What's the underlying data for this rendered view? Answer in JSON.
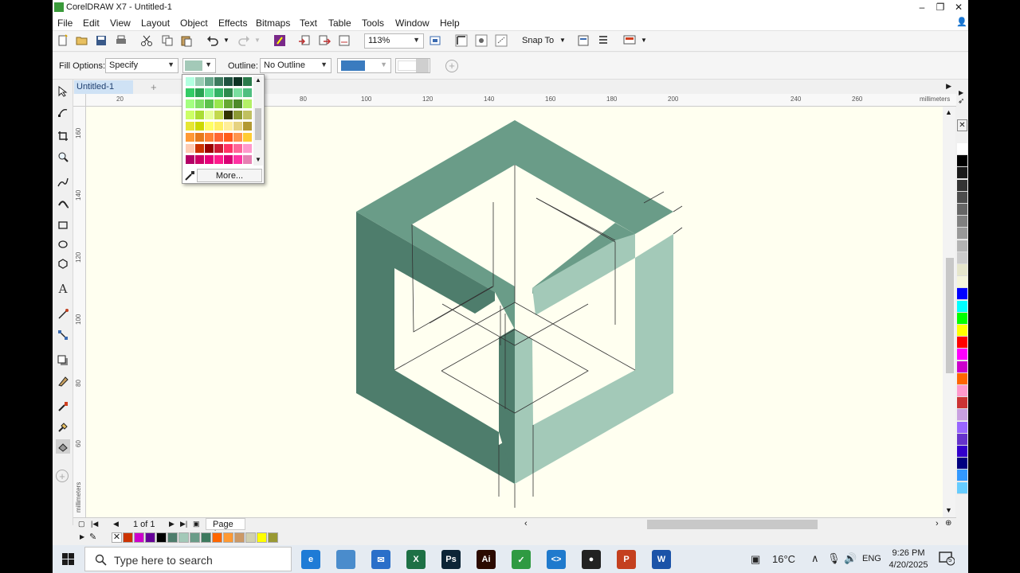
{
  "window": {
    "title": "CorelDRAW X7 - Untitled-1"
  },
  "menu": [
    "File",
    "Edit",
    "View",
    "Layout",
    "Object",
    "Effects",
    "Bitmaps",
    "Text",
    "Table",
    "Tools",
    "Window",
    "Help"
  ],
  "toolbar": {
    "zoom_value": "113%",
    "snap_label": "Snap To"
  },
  "property_bar": {
    "fill_options_label": "Fill Options:",
    "fill_options_value": "Specify",
    "outline_label": "Outline:",
    "outline_value": "No Outline",
    "fill_color": "#a3c9b8",
    "outline_color": "#3a7bbf"
  },
  "color_popup": {
    "more_label": "More...",
    "colors": [
      "#b2ffe0",
      "#99ccb3",
      "#66a68a",
      "#3d7a5e",
      "#1f5240",
      "#0d3324",
      "#2a7a4a",
      "#33cc66",
      "#29a352",
      "#66e699",
      "#33b366",
      "#2e8a4e",
      "#7adfa0",
      "#4fbf80",
      "#a3ff80",
      "#80e066",
      "#5cc24d",
      "#99e64d",
      "#66a833",
      "#4d8a2a",
      "#b3f066",
      "#ccff66",
      "#aadd33",
      "#e6ff99",
      "#c2d94d",
      "#333300",
      "#8c9933",
      "#c0c060",
      "#e6e633",
      "#ccd900",
      "#ffff66",
      "#fff066",
      "#ffee99",
      "#e6d280",
      "#b39933",
      "#ff9933",
      "#e67a1a",
      "#ff8033",
      "#ff6633",
      "#ff5c1a",
      "#ff944d",
      "#ffcc33",
      "#ffccb3",
      "#cc3300",
      "#990000",
      "#cc1a33",
      "#ff3366",
      "#ff6699",
      "#ff99cc",
      "#b30066",
      "#cc0066",
      "#e6007a",
      "#ff1a8c",
      "#d90073",
      "#ff33a3",
      "#e680b3"
    ]
  },
  "document": {
    "tab_label": "Untitled-1",
    "page_indicator": "1 of 1",
    "page_tab": "Page 1"
  },
  "rulers": {
    "horizontal": [
      "20",
      "80",
      "100",
      "120",
      "140",
      "160",
      "180",
      "200",
      "240",
      "260",
      "millimeters"
    ],
    "vertical": [
      "160",
      "140",
      "120",
      "100",
      "80",
      "60",
      "millimeters"
    ]
  },
  "cube": {
    "top_color": "#6a9c88",
    "left_color": "#4e7d6c",
    "right_color": "#a3c9b8",
    "line_color": "#333333"
  },
  "right_palette": [
    "#ffffff",
    "#000000",
    "#1a1a1a",
    "#333333",
    "#4d4d4d",
    "#666666",
    "#808080",
    "#999999",
    "#b3b3b3",
    "#cccccc",
    "#e6e6cc",
    "#f5f5dc",
    "#0000ff",
    "#00ffff",
    "#00ff00",
    "#ffff00",
    "#ff0000",
    "#ff00ff",
    "#cc00cc",
    "#ff6600",
    "#ff99cc",
    "#cc3333",
    "#c8a0e0",
    "#9966ff",
    "#6633cc",
    "#3300cc",
    "#000080",
    "#3399ff",
    "#66ccff"
  ],
  "doc_palette": [
    "#cc3300",
    "#cc00cc",
    "#660099",
    "#000000",
    "#4e7d6c",
    "#a3c9b8",
    "#6a9c88",
    "#3d7a5e",
    "#ff6600",
    "#ff9933",
    "#cc9966",
    "#d0d0b0",
    "#ffff00",
    "#999933"
  ],
  "taskbar": {
    "search_placeholder": "Type here to search",
    "temperature": "16°C",
    "language": "ENG",
    "time": "9:26 PM",
    "date": "4/20/2025",
    "notification_count": "5",
    "apps": [
      {
        "name": "edge",
        "color": "#1e7bd6",
        "label": "e"
      },
      {
        "name": "app-blue",
        "color": "#4a8ccc",
        "label": ""
      },
      {
        "name": "mail",
        "color": "#2a6fc9",
        "label": "✉"
      },
      {
        "name": "excel",
        "color": "#1d7045",
        "label": "X"
      },
      {
        "name": "photoshop",
        "color": "#0c2436",
        "label": "Ps"
      },
      {
        "name": "illustrator",
        "color": "#2b0a00",
        "label": "Ai"
      },
      {
        "name": "coreldraw",
        "color": "#2f9a42",
        "label": "✓"
      },
      {
        "name": "vscode",
        "color": "#1f7acd",
        "label": "<>"
      },
      {
        "name": "obs",
        "color": "#222222",
        "label": "●"
      },
      {
        "name": "powerpoint",
        "color": "#c4401f",
        "label": "P"
      },
      {
        "name": "word",
        "color": "#1b53a8",
        "label": "W"
      }
    ]
  }
}
